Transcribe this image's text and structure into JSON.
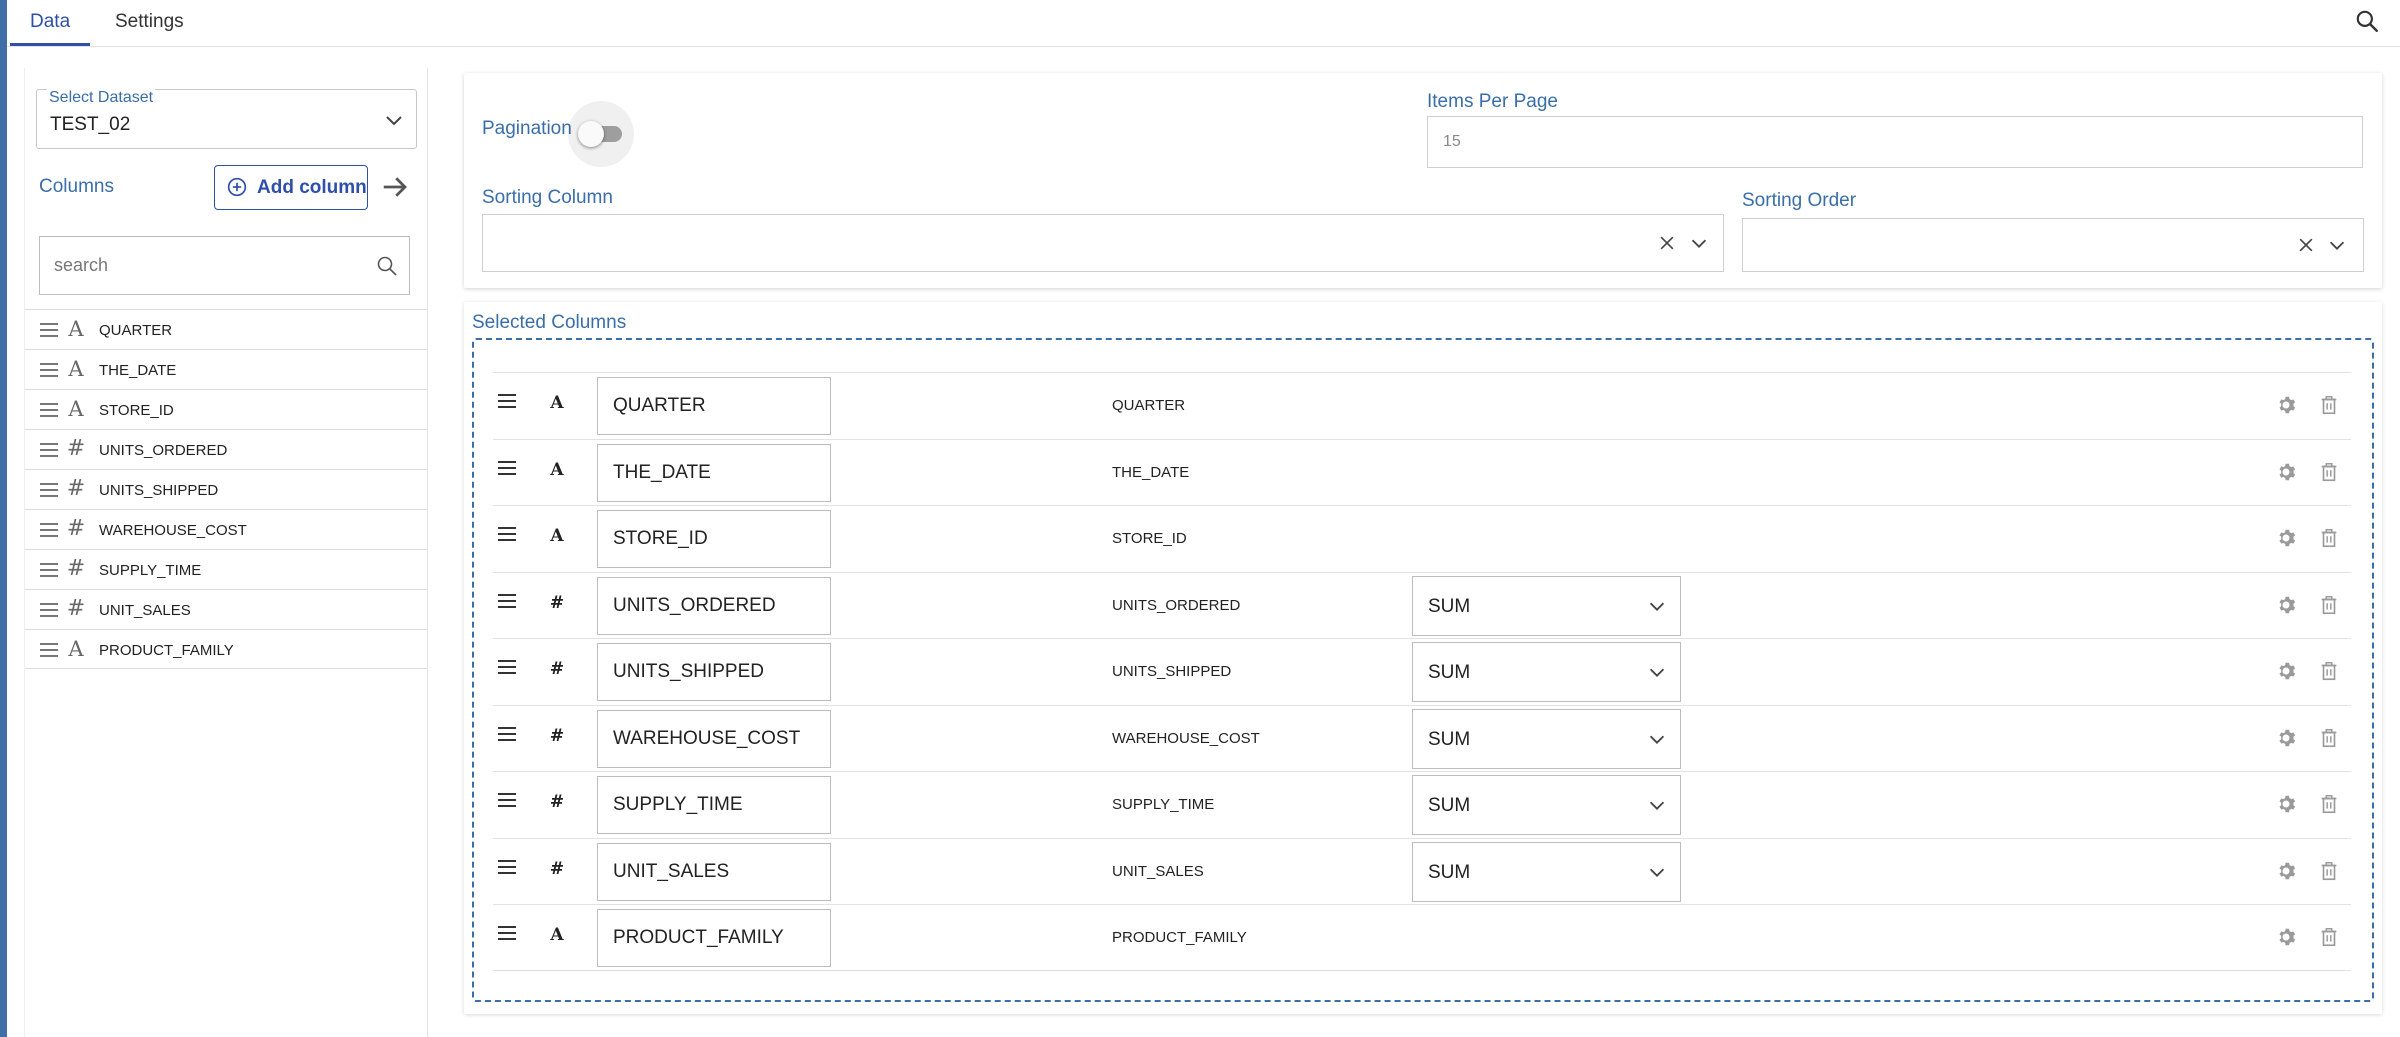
{
  "tabs": [
    {
      "label": "Data",
      "active": true
    },
    {
      "label": "Settings",
      "active": false
    }
  ],
  "dataset": {
    "label": "Select Dataset",
    "value": "TEST_02"
  },
  "columns_panel": {
    "label": "Columns",
    "add_button": "Add column",
    "search_placeholder": "search",
    "items": [
      {
        "name": "QUARTER",
        "type": "text"
      },
      {
        "name": "THE_DATE",
        "type": "text"
      },
      {
        "name": "STORE_ID",
        "type": "text"
      },
      {
        "name": "UNITS_ORDERED",
        "type": "number"
      },
      {
        "name": "UNITS_SHIPPED",
        "type": "number"
      },
      {
        "name": "WAREHOUSE_COST",
        "type": "number"
      },
      {
        "name": "SUPPLY_TIME",
        "type": "number"
      },
      {
        "name": "UNIT_SALES",
        "type": "number"
      },
      {
        "name": "PRODUCT_FAMILY",
        "type": "text"
      }
    ]
  },
  "settings": {
    "pagination_label": "Pagination",
    "pagination_enabled": false,
    "items_per_page_label": "Items Per Page",
    "items_per_page_value": "15",
    "sorting_column_label": "Sorting Column",
    "sorting_column_value": "",
    "sorting_order_label": "Sorting Order",
    "sorting_order_value": ""
  },
  "selected": {
    "title": "Selected Columns",
    "rows": [
      {
        "alias": "QUARTER",
        "original": "QUARTER",
        "type": "text",
        "agg": ""
      },
      {
        "alias": "THE_DATE",
        "original": "THE_DATE",
        "type": "text",
        "agg": ""
      },
      {
        "alias": "STORE_ID",
        "original": "STORE_ID",
        "type": "text",
        "agg": ""
      },
      {
        "alias": "UNITS_ORDERED",
        "original": "UNITS_ORDERED",
        "type": "number",
        "agg": "SUM"
      },
      {
        "alias": "UNITS_SHIPPED",
        "original": "UNITS_SHIPPED",
        "type": "number",
        "agg": "SUM"
      },
      {
        "alias": "WAREHOUSE_COST",
        "original": "WAREHOUSE_COST",
        "type": "number",
        "agg": "SUM"
      },
      {
        "alias": "SUPPLY_TIME",
        "original": "SUPPLY_TIME",
        "type": "number",
        "agg": "SUM"
      },
      {
        "alias": "UNIT_SALES",
        "original": "UNIT_SALES",
        "type": "number",
        "agg": "SUM"
      },
      {
        "alias": "PRODUCT_FAMILY",
        "original": "PRODUCT_FAMILY",
        "type": "text",
        "agg": ""
      }
    ]
  },
  "type_glyphs": {
    "text": "A",
    "number": "#"
  },
  "colors": {
    "accent": "#2f4fa8",
    "label_blue": "#3a6ea8",
    "side_strip": "#3f6fa6"
  }
}
